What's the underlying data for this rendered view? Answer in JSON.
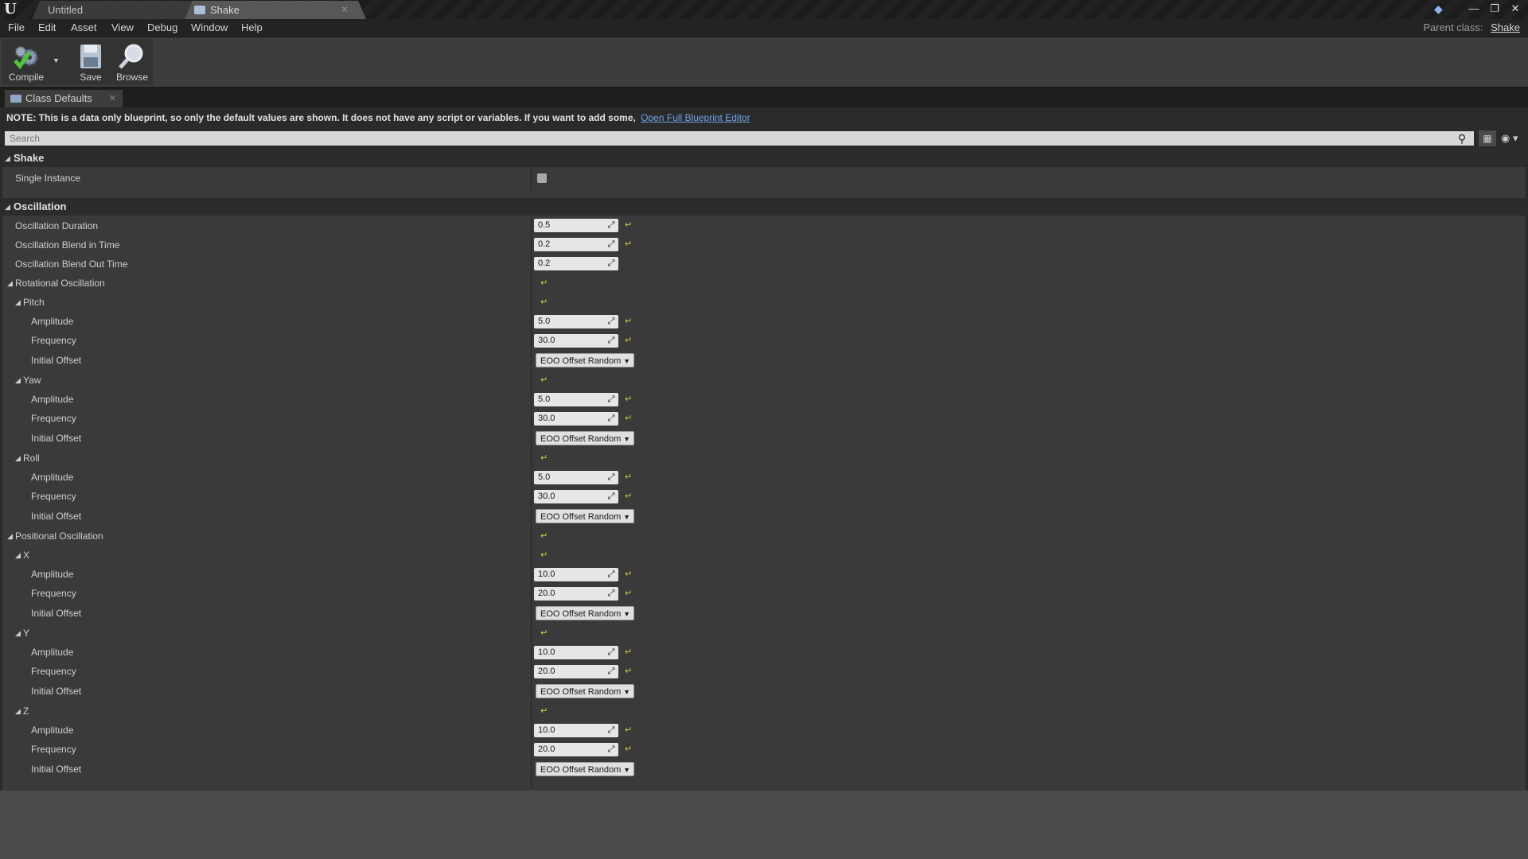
{
  "window": {
    "tabs": [
      {
        "label": "Untitled"
      },
      {
        "label": "Shake"
      }
    ],
    "notify_icon": "notification-icon",
    "controls": [
      "minimize-icon",
      "restore-icon",
      "close-icon"
    ]
  },
  "menu": {
    "items": [
      "File",
      "Edit",
      "Asset",
      "View",
      "Debug",
      "Window",
      "Help"
    ],
    "parent_class_label": "Parent class:",
    "parent_class_value": "Shake"
  },
  "toolbar": {
    "compile_label": "Compile",
    "save_label": "Save",
    "browse_label": "Browse"
  },
  "doc_tab": {
    "label": "Class Defaults"
  },
  "note": {
    "text": "NOTE: This is a data only blueprint, so only the default values are shown.  It does not have any script or variables.  If you want to add some,",
    "link": "Open Full Blueprint Editor"
  },
  "search": {
    "placeholder": "Search"
  },
  "categories": {
    "shake": {
      "title": "Shake",
      "single_instance_label": "Single Instance",
      "single_instance_checked": false
    },
    "oscillation": {
      "title": "Oscillation",
      "duration_label": "Oscillation Duration",
      "duration_value": "0.5",
      "blend_in_label": "Oscillation Blend in Time",
      "blend_in_value": "0.2",
      "blend_out_label": "Oscillation Blend Out Time",
      "blend_out_value": "0.2",
      "rotational_label": "Rotational Oscillation",
      "positional_label": "Positional Oscillation",
      "amplitude_label": "Amplitude",
      "frequency_label": "Frequency",
      "initial_offset_label": "Initial Offset",
      "offset_value": "EOO Offset Random",
      "pitch": {
        "label": "Pitch",
        "amplitude": "5.0",
        "frequency": "30.0"
      },
      "yaw": {
        "label": "Yaw",
        "amplitude": "5.0",
        "frequency": "30.0"
      },
      "roll": {
        "label": "Roll",
        "amplitude": "5.0",
        "frequency": "30.0"
      },
      "x": {
        "label": "X",
        "amplitude": "10.0",
        "frequency": "20.0"
      },
      "y": {
        "label": "Y",
        "amplitude": "10.0",
        "frequency": "20.0"
      },
      "z": {
        "label": "Z",
        "amplitude": "10.0",
        "frequency": "20.0"
      }
    }
  },
  "colors": {
    "reset_arrow": "#d9c84a",
    "link": "#6fa4e6",
    "panel": "#3a3a3a"
  }
}
